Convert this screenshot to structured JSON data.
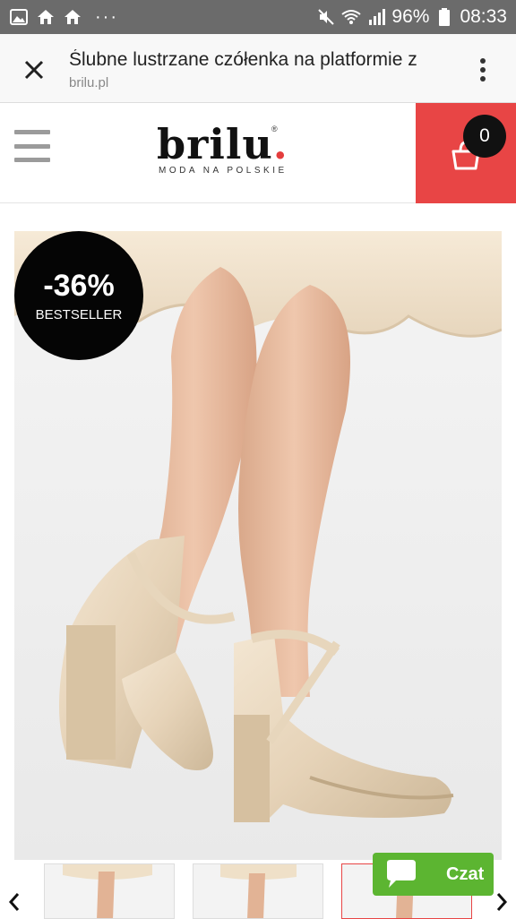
{
  "status_bar": {
    "battery": "96%",
    "time": "08:33",
    "icons": [
      "gallery-icon",
      "home-icon",
      "home-icon",
      "more-dots-icon",
      "mute-icon",
      "wifi-icon",
      "signal-icon",
      "battery-icon"
    ]
  },
  "tab": {
    "title": "Ślubne lustrzane czółenka na platformie z",
    "url": "brilu.pl",
    "close_icon": "close-icon",
    "menu_icon": "more-vert-icon"
  },
  "header": {
    "logo_word": "brilu",
    "logo_dot": ".",
    "logo_reg": "®",
    "logo_tagline": "MODA NA POLSKIE",
    "cart_count": "0",
    "colors": {
      "accent": "#e84545",
      "menu": "#9b9b9b"
    }
  },
  "product": {
    "badge_discount": "-36%",
    "badge_label": "BESTSELLER"
  },
  "chat": {
    "label": "Czat",
    "color": "#5cb531"
  }
}
